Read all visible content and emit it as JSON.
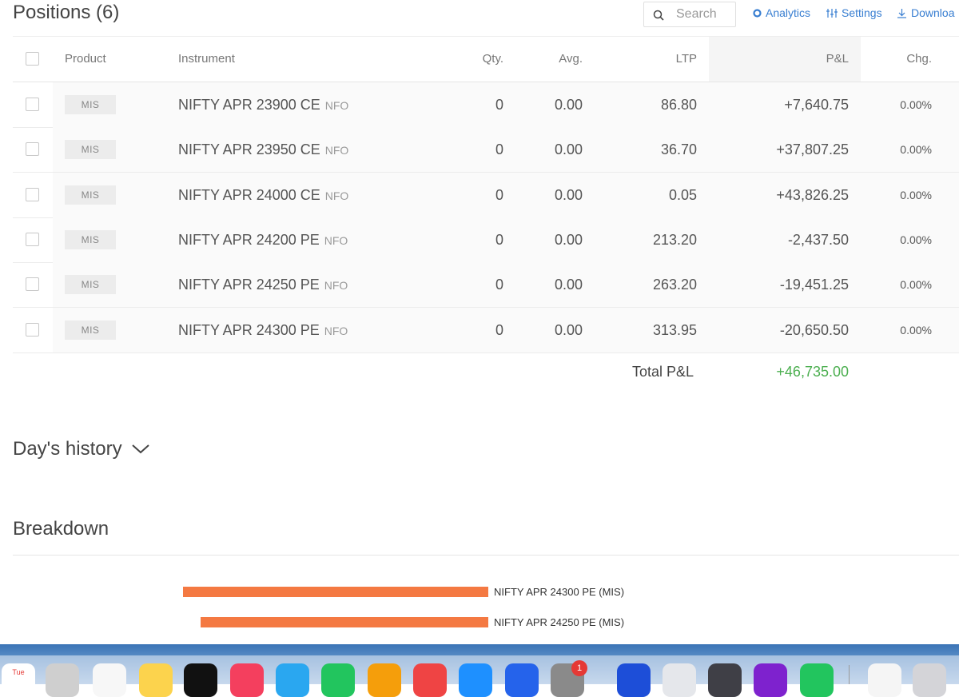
{
  "title": "Positions (6)",
  "search": {
    "placeholder": "Search",
    "value": ""
  },
  "toolbar": {
    "analytics": "Analytics",
    "settings": "Settings",
    "download": "Downloa"
  },
  "columns": {
    "product": "Product",
    "instrument": "Instrument",
    "qty": "Qty.",
    "avg": "Avg.",
    "ltp": "LTP",
    "pnl": "P&L",
    "chg": "Chg."
  },
  "positions": [
    {
      "product": "MIS",
      "instrument": "NIFTY APR 23900 CE",
      "exchange": "NFO",
      "qty": "0",
      "avg": "0.00",
      "ltp": "86.80",
      "pnl": "+7,640.75",
      "chg": "0.00%"
    },
    {
      "product": "MIS",
      "instrument": "NIFTY APR 23950 CE",
      "exchange": "NFO",
      "qty": "0",
      "avg": "0.00",
      "ltp": "36.70",
      "pnl": "+37,807.25",
      "chg": "0.00%"
    },
    {
      "product": "MIS",
      "instrument": "NIFTY APR 24000 CE",
      "exchange": "NFO",
      "qty": "0",
      "avg": "0.00",
      "ltp": "0.05",
      "pnl": "+43,826.25",
      "chg": "0.00%"
    },
    {
      "product": "MIS",
      "instrument": "NIFTY APR 24200 PE",
      "exchange": "NFO",
      "qty": "0",
      "avg": "0.00",
      "ltp": "213.20",
      "pnl": "-2,437.50",
      "chg": "0.00%"
    },
    {
      "product": "MIS",
      "instrument": "NIFTY APR 24250 PE",
      "exchange": "NFO",
      "qty": "0",
      "avg": "0.00",
      "ltp": "263.20",
      "pnl": "-19,451.25",
      "chg": "0.00%"
    },
    {
      "product": "MIS",
      "instrument": "NIFTY APR 24300 PE",
      "exchange": "NFO",
      "qty": "0",
      "avg": "0.00",
      "ltp": "313.95",
      "pnl": "-20,650.50",
      "chg": "0.00%"
    }
  ],
  "total": {
    "label": "Total P&L",
    "value": "+46,735.00"
  },
  "day_history": {
    "label": "Day's history"
  },
  "breakdown": {
    "title": "Breakdown",
    "items": [
      {
        "label": "NIFTY APR 24300 PE (MIS)",
        "value": -20650.5
      },
      {
        "label": "NIFTY APR 24250 PE (MIS)",
        "value": -19451.25
      }
    ]
  },
  "dock": {
    "calendar_day": "Tue",
    "badge_count": "1"
  },
  "colors": {
    "accent": "#387ed1",
    "profit": "#4caf50",
    "bar": "#f47942"
  }
}
